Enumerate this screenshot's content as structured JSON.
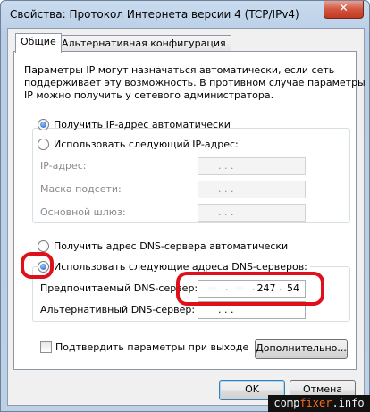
{
  "window": {
    "title": "Свойства: Протокол Интернета версии 4 (TCP/IPv4)",
    "close_glyph": "✕"
  },
  "tabs": [
    {
      "label": "Общие",
      "active": true
    },
    {
      "label": "Альтернативная конфигурация",
      "active": false
    }
  ],
  "general": {
    "intro": [
      "Параметры IP могут назначаться автоматически, если сеть",
      "поддерживает эту возможность. В противном случае параметры",
      "IP можно получить у сетевого администратора."
    ],
    "ip_auto_label": "Получить IP-адрес автоматически",
    "ip_manual_label": "Использовать следующий IP-адрес:",
    "ip_fields": {
      "ip_label": "IP-адрес:",
      "mask_label": "Маска подсети:",
      "gateway_label": "Основной шлюз:",
      "dots": ".   .   ."
    },
    "dns_auto_label": "Получить адрес DNS-сервера автоматически",
    "dns_manual_label": "Использовать следующие адреса DNS-серверов:",
    "preferred_dns": {
      "label": "Предпочитаемый DNS-сервер:",
      "octets": [
        "",
        "",
        "247",
        "54"
      ]
    },
    "alternate_dns": {
      "label": "Альтернативный DNS-сервер:"
    },
    "validate_label": "Подтвердить параметры при выходе",
    "advanced_button": "Дополнительно..."
  },
  "buttons": {
    "ok": "OK",
    "cancel": "Отмена"
  },
  "watermark": {
    "prefix": "comp",
    "accent": "fixer",
    "suffix": ".info"
  },
  "colors": {
    "highlight_oval": "#e0101a",
    "title_bg": "#c9dbee"
  }
}
